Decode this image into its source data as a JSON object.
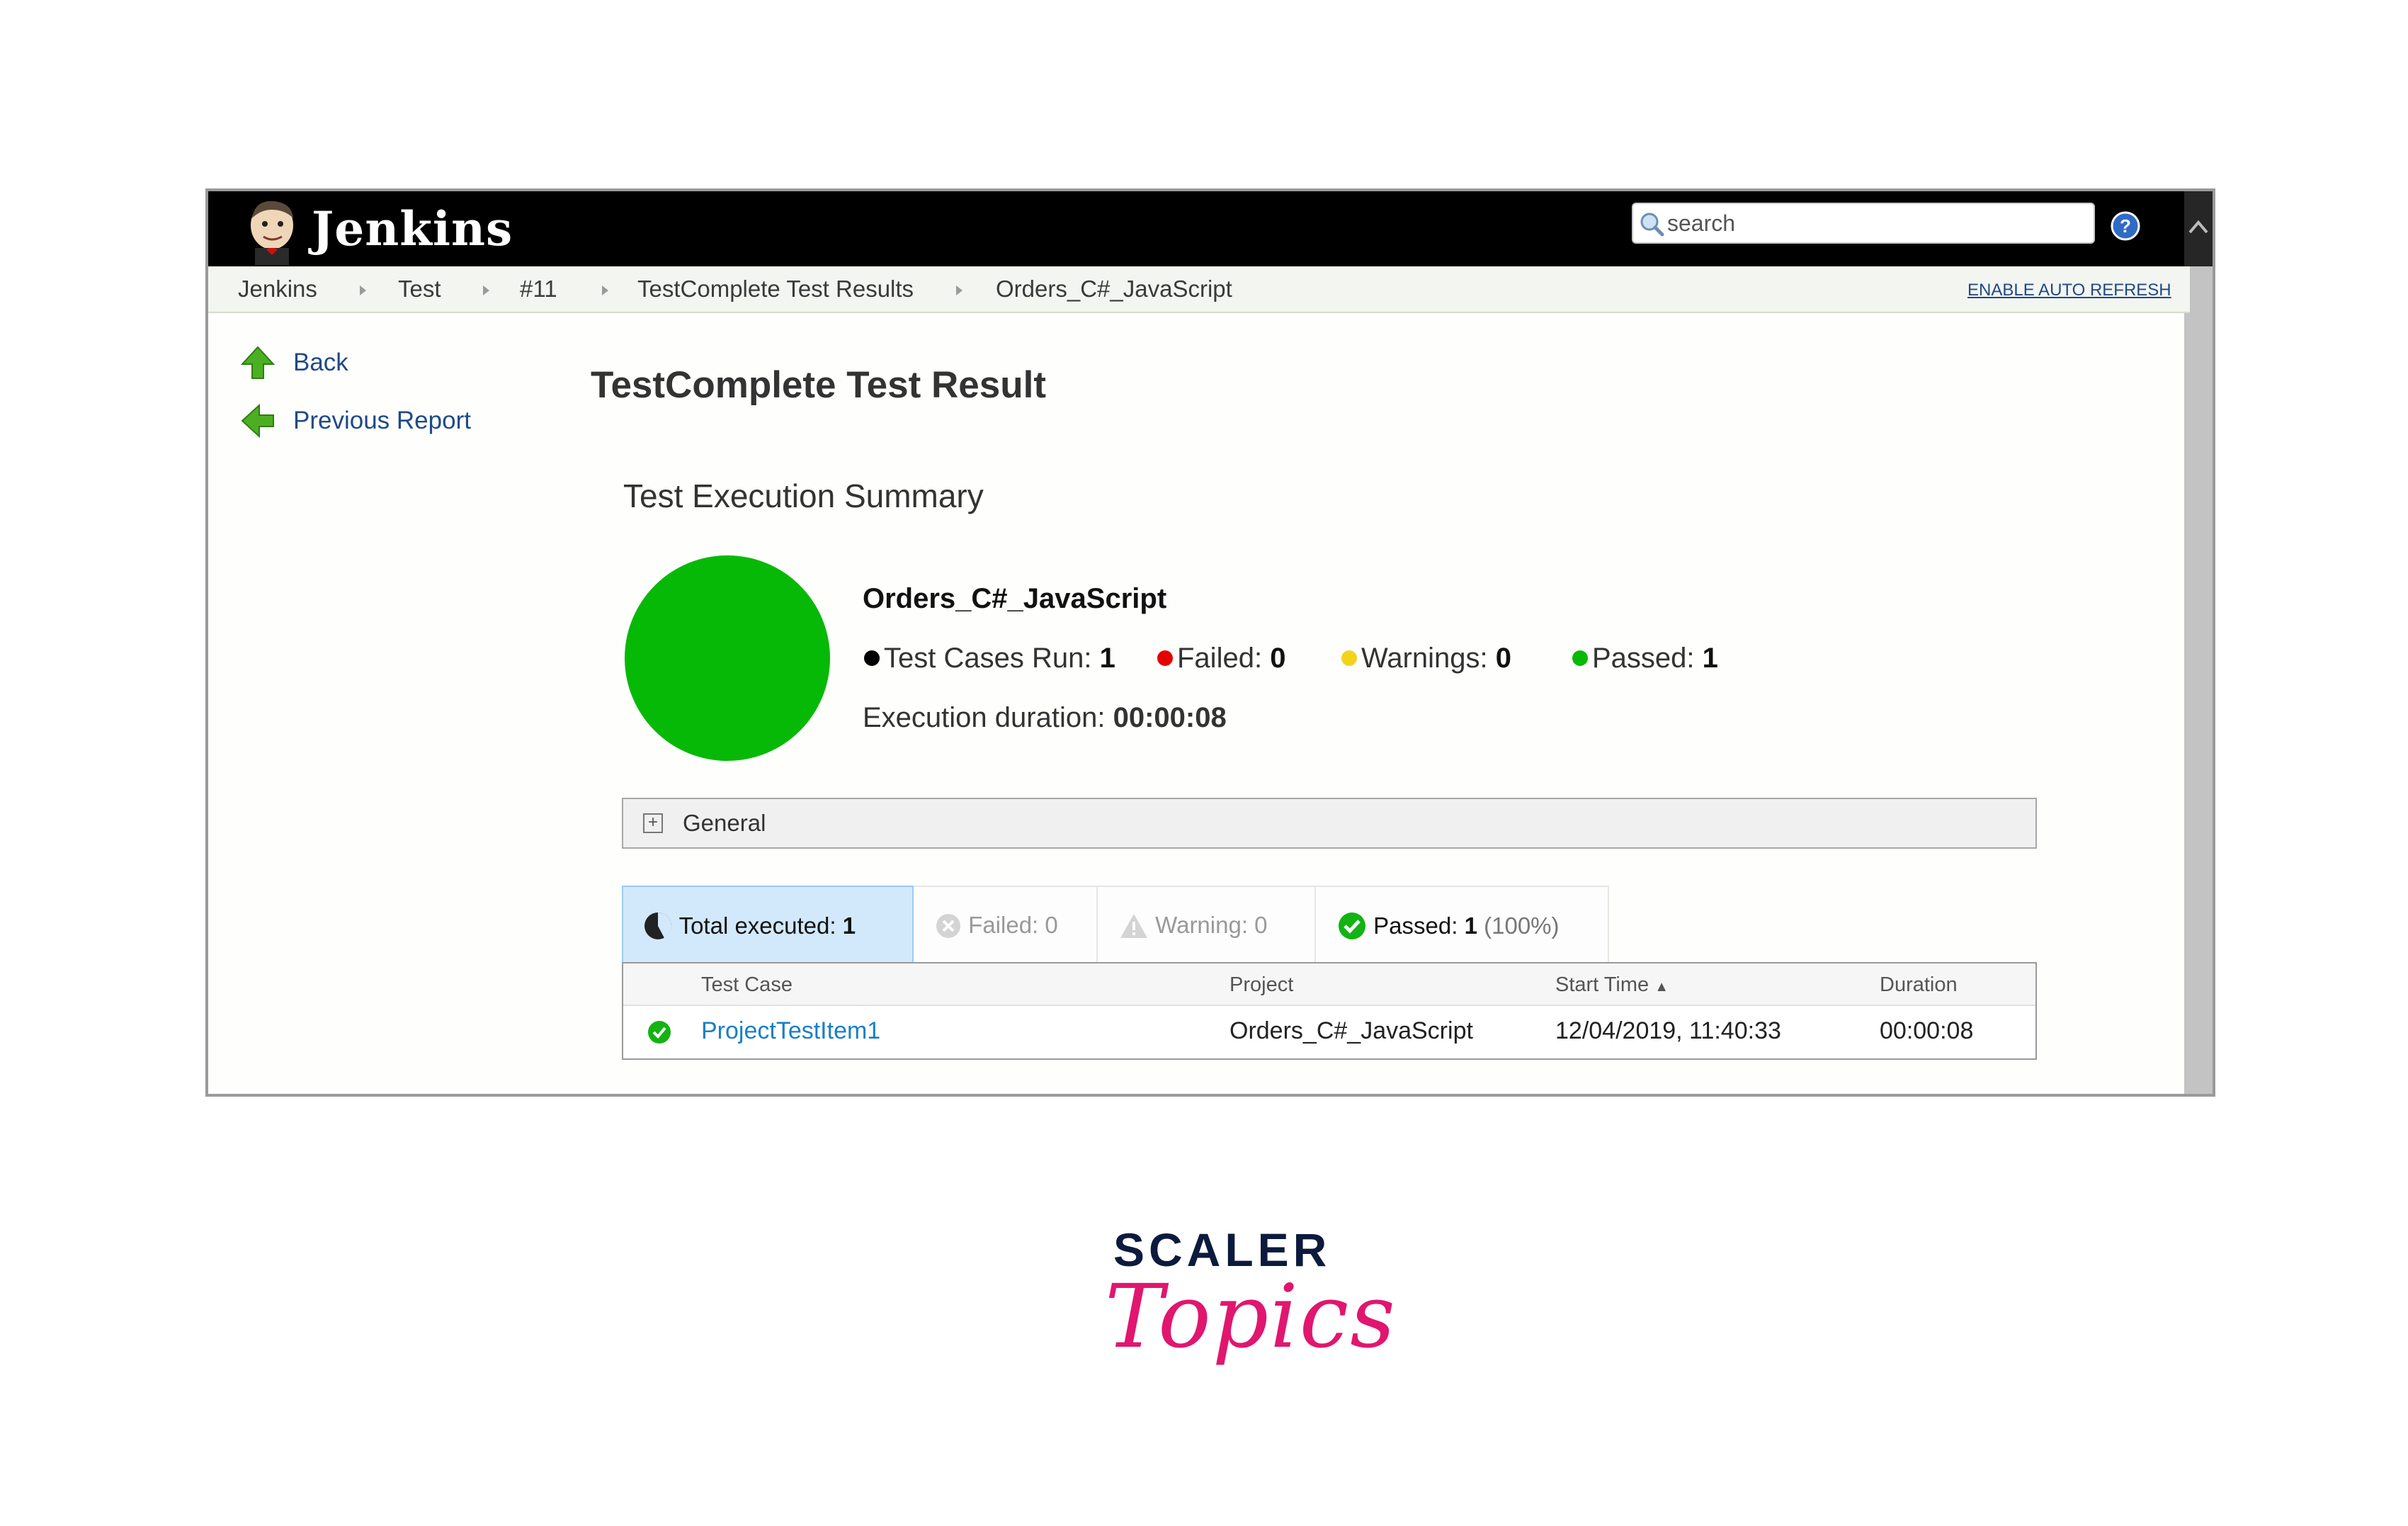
{
  "header": {
    "brand": "Jenkins",
    "search_placeholder": "search"
  },
  "breadcrumb": {
    "items": [
      "Jenkins",
      "Test",
      "#11",
      "TestComplete Test Results",
      "Orders_C#_JavaScript"
    ],
    "auto_refresh": "ENABLE AUTO REFRESH"
  },
  "side_panel": {
    "back": "Back",
    "previous_report": "Previous Report"
  },
  "main": {
    "title": "TestComplete Test Result",
    "summary_title": "Test Execution Summary",
    "status_color": "#07b907",
    "project_name": "Orders_C#_JavaScript",
    "stats": {
      "run_label": "Test Cases Run:",
      "run_value": "1",
      "failed_label": "Failed:",
      "failed_value": "0",
      "warnings_label": "Warnings:",
      "warnings_value": "0",
      "passed_label": "Passed:",
      "passed_value": "1"
    },
    "duration_label": "Execution duration:",
    "duration_value": "00:00:08",
    "general_label": "General"
  },
  "tabs": {
    "total_label": "Total executed:",
    "total_value": "1",
    "failed_label": "Failed: 0",
    "warning_label": "Warning: 0",
    "passed_label": "Passed:",
    "passed_value": "1",
    "passed_pct": "(100%)"
  },
  "table": {
    "columns": [
      "Test Case",
      "Project",
      "Start Time",
      "Duration"
    ],
    "sort_indicator": "▲",
    "rows": [
      {
        "test_case": "ProjectTestItem1",
        "project": "Orders_C#_JavaScript",
        "start_time": "12/04/2019, 11:40:33",
        "duration": "00:00:08"
      }
    ]
  },
  "watermark": {
    "line1": "SCALER",
    "line2": "Topics"
  },
  "colors": {
    "header_bg": "#000000",
    "link": "#204a87",
    "passed": "#07b907",
    "failed": "#e60000",
    "warning": "#f2d31a",
    "tab_active": "#d2e9fb"
  }
}
